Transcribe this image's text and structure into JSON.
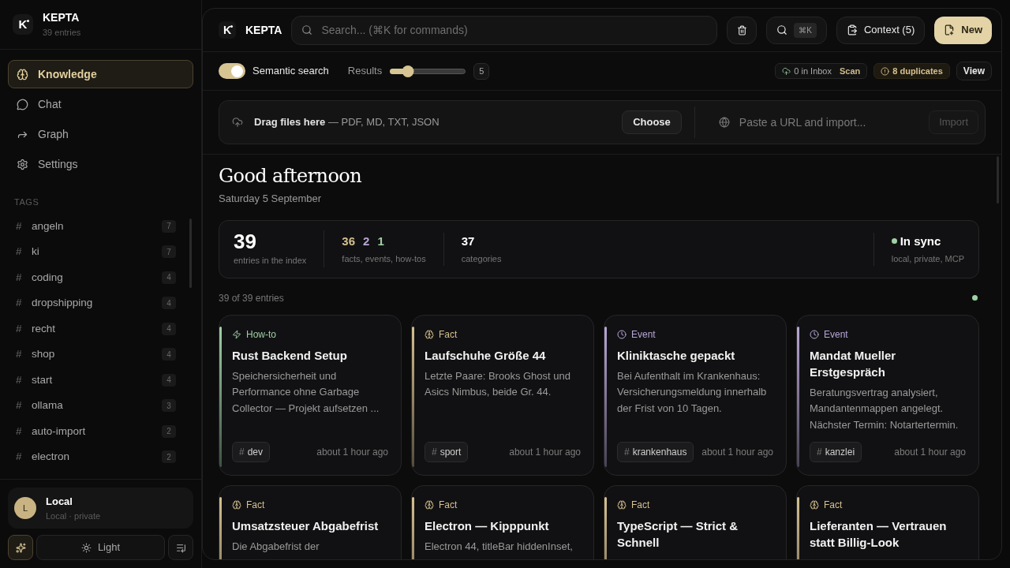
{
  "sidebar": {
    "app_name": "KEPTA",
    "entry_count": "39 entries",
    "logo_letter": "K",
    "nav": [
      {
        "label": "Knowledge",
        "selected": true
      },
      {
        "label": "Chat",
        "selected": false
      },
      {
        "label": "Graph",
        "selected": false
      },
      {
        "label": "Settings",
        "selected": false
      }
    ],
    "tags_heading": "TAGS",
    "tags": [
      {
        "hash": "#",
        "name": "angeln",
        "count": "7"
      },
      {
        "hash": "#",
        "name": "ki",
        "count": "7"
      },
      {
        "hash": "#",
        "name": "coding",
        "count": "4"
      },
      {
        "hash": "#",
        "name": "dropshipping",
        "count": "4"
      },
      {
        "hash": "#",
        "name": "recht",
        "count": "4"
      },
      {
        "hash": "#",
        "name": "shop",
        "count": "4"
      },
      {
        "hash": "#",
        "name": "start",
        "count": "4"
      },
      {
        "hash": "#",
        "name": "ollama",
        "count": "3"
      },
      {
        "hash": "#",
        "name": "auto-import",
        "count": "2"
      },
      {
        "hash": "#",
        "name": "electron",
        "count": "2"
      }
    ],
    "profile": {
      "initial": "L",
      "name": "Local",
      "subtitle": "Local · private"
    },
    "theme_button": "Light"
  },
  "topbar": {
    "logo_letter": "K",
    "app_name": "KEPTA",
    "search_placeholder": "Search... (⌘K for commands)",
    "shortcut": "⌘K",
    "context_button": "Context (5)",
    "new_button": "New"
  },
  "toolbar": {
    "semantic_search": {
      "label": "Semantic search",
      "on": true
    },
    "results": {
      "label": "Results",
      "level": 0.24,
      "value": "5"
    },
    "inbox": {
      "label": "0 in Inbox",
      "action": "Scan"
    },
    "duplicates": "8 duplicates",
    "view_button": "View"
  },
  "import": {
    "drag_label": "Drag files here",
    "drag_hint": "— PDF, MD, TXT, JSON",
    "choose_button": "Choose",
    "url_placeholder": "Paste a URL and import...",
    "import_button": "Import"
  },
  "greeting": {
    "title": "Good afternoon",
    "date": "Saturday 5 September"
  },
  "stats": {
    "total": "39",
    "total_label": "entries in the index",
    "counts": [
      {
        "value": "36",
        "color": "#d6c08f"
      },
      {
        "value": "2",
        "color": "#b7a6d6"
      },
      {
        "value": "1",
        "color": "#9fd0a6"
      }
    ],
    "counts_label": "facts, events, how-tos",
    "categories": "37",
    "categories_label": "categories",
    "sync": "In sync",
    "sync_detail": "local, private, MCP"
  },
  "list_count": "39 of 39 entries",
  "cards": [
    {
      "kind": "howto",
      "type_label": "How-to",
      "title": "Rust Backend Setup",
      "body": "Speichersicherheit und Performance ohne Garbage Collector — Projekt aufsetzen ...",
      "tag_hash": "#",
      "tag": "dev",
      "time": "about 1 hour ago"
    },
    {
      "kind": "fact",
      "type_label": "Fact",
      "title": "Laufschuhe Größe 44",
      "body": "Letzte Paare: Brooks Ghost und Asics Nimbus, beide Gr. 44.",
      "tag_hash": "#",
      "tag": "sport",
      "time": "about 1 hour ago"
    },
    {
      "kind": "event",
      "type_label": "Event",
      "title": "Kliniktasche gepackt",
      "body": "Bei Aufenthalt im Krankenhaus: Versicherungsmeldung innerhalb der Frist von 10 Tagen.",
      "tag_hash": "#",
      "tag": "krankenhaus",
      "time": "about 1 hour ago"
    },
    {
      "kind": "event",
      "type_label": "Event",
      "title": "Mandat Mueller Erstgespräch",
      "body": "Beratungsvertrag analysiert, Mandantenmappen angelegt. Nächster Termin: Notartertermin.",
      "tag_hash": "#",
      "tag": "kanzlei",
      "time": "about 1 hour ago"
    },
    {
      "kind": "fact",
      "type_label": "Fact",
      "title": "Umsatzsteuer Abgabefrist",
      "body": "Die Abgabefrist der"
    },
    {
      "kind": "fact",
      "type_label": "Fact",
      "title": "Electron — Kipppunkt",
      "body": "Electron 44, titleBar hiddenInset,"
    },
    {
      "kind": "fact",
      "type_label": "Fact",
      "title": "TypeScript — Strict & Schnell"
    },
    {
      "kind": "fact",
      "type_label": "Fact",
      "title": "Lieferanten — Vertrauen statt Billig-Look"
    }
  ]
}
